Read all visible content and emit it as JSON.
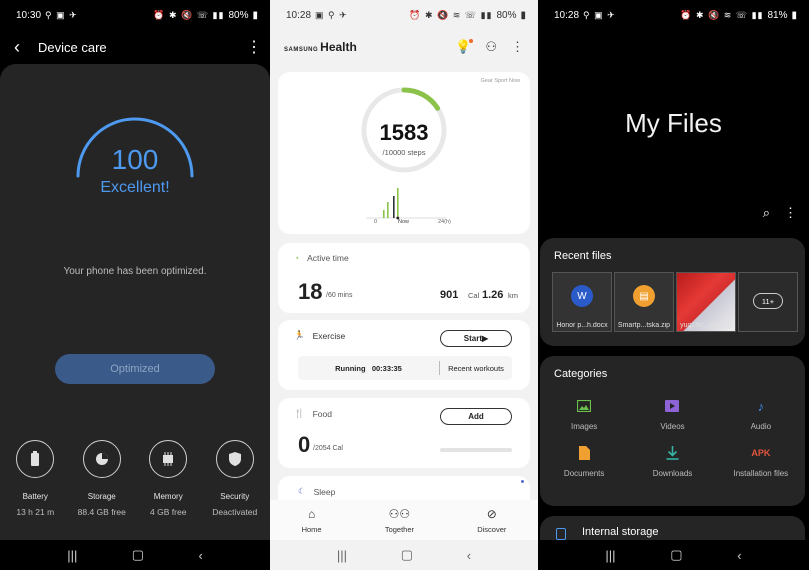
{
  "device_care": {
    "status": {
      "time": "10:30",
      "battery": "80%"
    },
    "title": "Device care",
    "score": "100",
    "grade": "Excellent!",
    "message": "Your phone has been optimized.",
    "button": "Optimized",
    "gauge_fill": 1.0,
    "tiles": [
      {
        "label": "Battery",
        "value": "13 h 21 m",
        "icon": "battery-icon"
      },
      {
        "label": "Storage",
        "value": "88.4 GB free",
        "icon": "storage-pie-icon"
      },
      {
        "label": "Memory",
        "value": "4 GB free",
        "icon": "memory-chip-icon"
      },
      {
        "label": "Security",
        "value": "Deactivated",
        "icon": "shield-icon"
      }
    ]
  },
  "health": {
    "status": {
      "time": "10:28",
      "battery": "80%"
    },
    "brand_prefix": "SAMSUNG",
    "brand": "Health",
    "gear_note": "Gear Sport Now",
    "steps": {
      "count": "1583",
      "goal": "/10000 steps",
      "progress": 0.1583,
      "axis_start": "0",
      "axis_now": "Now",
      "axis_end": "24(h)"
    },
    "active_time": {
      "label": "Active time",
      "minutes": "18",
      "minutes_unit": "/60 mins",
      "cal": "901",
      "cal_unit": "Cal",
      "km": "1.26",
      "km_unit": "km"
    },
    "exercise": {
      "label": "Exercise",
      "start": "Start",
      "running": "Running",
      "duration": "00:33:35",
      "recent": "Recent workouts"
    },
    "food": {
      "label": "Food",
      "add": "Add",
      "value": "0",
      "unit": "/2054 Cal"
    },
    "sleep": {
      "label": "Sleep"
    },
    "nav": [
      {
        "label": "Home",
        "icon": "home-icon"
      },
      {
        "label": "Together",
        "icon": "people-icon"
      },
      {
        "label": "Discover",
        "icon": "compass-icon"
      }
    ],
    "colors": {
      "accent_green": "#8bc34a"
    }
  },
  "my_files": {
    "status": {
      "time": "10:28",
      "battery": "81%"
    },
    "title": "My Files",
    "recent_title": "Recent files",
    "recent": [
      {
        "caption": "Honor p...h.docx",
        "icon": "word-doc-icon"
      },
      {
        "caption": "Smartp...tska.zip",
        "icon": "zip-folder-icon"
      },
      {
        "caption": "yug16d...040.jpg",
        "icon": "image-thumbnail"
      },
      {
        "caption": "11+",
        "icon": "more-files-icon"
      }
    ],
    "categories_title": "Categories",
    "categories": [
      {
        "label": "Images",
        "icon": "image-icon",
        "color": "#6bc04b"
      },
      {
        "label": "Videos",
        "icon": "video-icon",
        "color": "#8e63d6"
      },
      {
        "label": "Audio",
        "icon": "music-note-icon",
        "color": "#3c8ee8"
      },
      {
        "label": "Documents",
        "icon": "document-icon",
        "color": "#f0a030"
      },
      {
        "label": "Downloads",
        "icon": "download-icon",
        "color": "#34b3a6"
      },
      {
        "label": "Installation files",
        "icon": "apk-icon",
        "apk_text": "APK",
        "color": "#e2543e"
      }
    ],
    "internal_storage": "Internal storage"
  }
}
